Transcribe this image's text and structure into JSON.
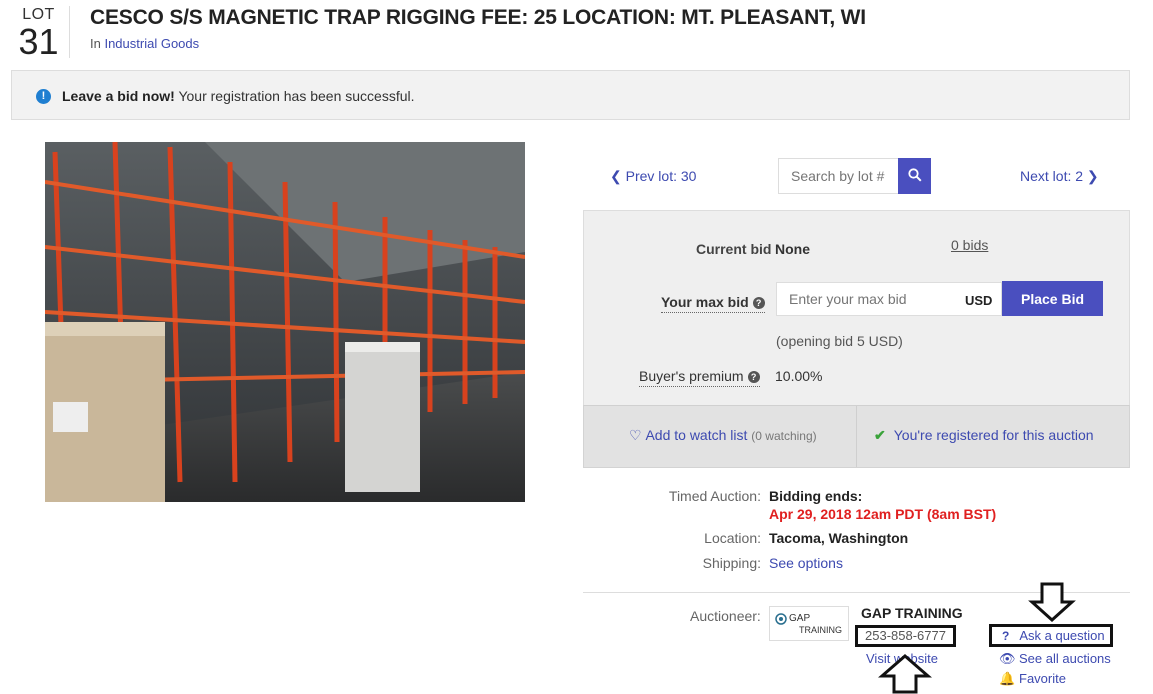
{
  "header": {
    "lot_label": "LOT",
    "lot_number": "31",
    "title": "CESCO S/S MAGNETIC TRAP RIGGING FEE: 25 LOCATION: MT. PLEASANT, WI",
    "category_prefix": "In",
    "category": "Industrial Goods"
  },
  "alert": {
    "icon": "info-icon",
    "bold": "Leave a bid now!",
    "text": "Your registration has been successful."
  },
  "nav": {
    "prev": "Prev lot: 30",
    "next": "Next lot: 2",
    "search_placeholder": "Search by lot #"
  },
  "bid": {
    "current_bid_label": "Current bid",
    "current_bid_value": "None",
    "bids_link": "0 bids",
    "max_bid_label": "Your max bid",
    "max_bid_placeholder": "Enter your max bid",
    "currency": "USD",
    "place_bid": "Place Bid",
    "opening_bid": "(opening bid 5 USD)",
    "premium_label": "Buyer's premium",
    "premium_value": "10.00%",
    "watch_label": "Add to watch list",
    "watch_count": "(0 watching)",
    "registered": "You're registered for this auction"
  },
  "details": {
    "auction_label": "Timed Auction:",
    "bidding_ends_label": "Bidding ends:",
    "bidding_ends_date": "Apr 29, 2018 12am PDT (8am BST)",
    "location_label": "Location:",
    "location_value": "Tacoma, Washington",
    "shipping_label": "Shipping:",
    "shipping_link": "See options"
  },
  "auctioneer": {
    "label": "Auctioneer:",
    "logo_text_1": "GAP",
    "logo_text_2": "TRAINING",
    "name": "GAP TRAINING",
    "phone": "253-858-6777",
    "visit": "Visit website",
    "ask": "Ask a question",
    "see_all": "See all auctions",
    "favorite": "Favorite"
  },
  "colors": {
    "accent": "#4a4fbf",
    "link": "#3d4ab0",
    "deadline": "#e02020",
    "check": "#3aa33a"
  }
}
